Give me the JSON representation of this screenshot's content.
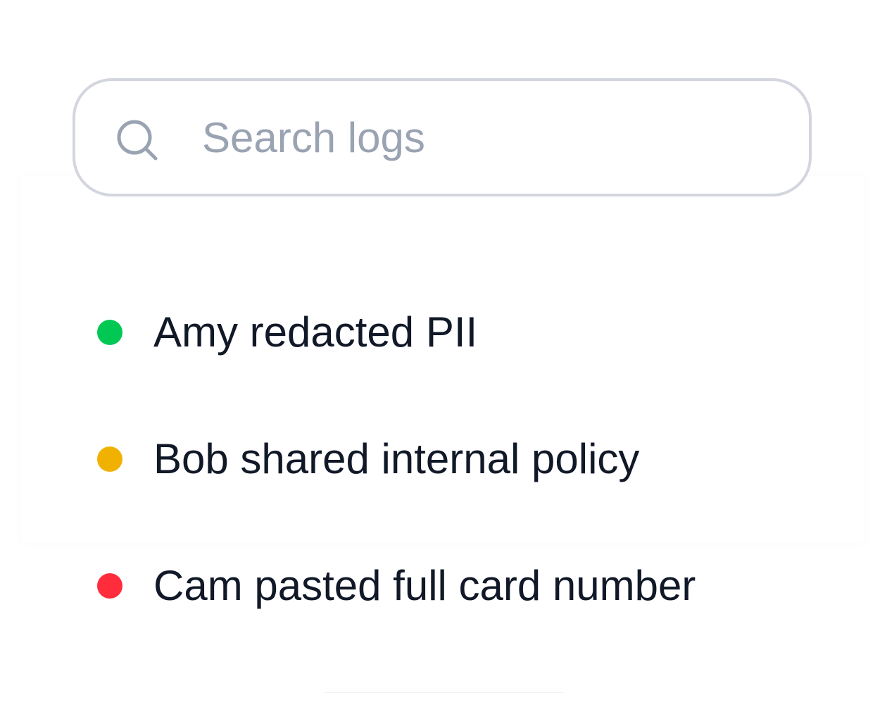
{
  "search": {
    "placeholder": "Search logs",
    "icon": "search-icon"
  },
  "logs": [
    {
      "text": "Amy redacted PII",
      "status": "ok",
      "color": "#00c853"
    },
    {
      "text": "Bob shared internal policy",
      "status": "warning",
      "color": "#f0b100"
    },
    {
      "text": "Cam pasted full card number",
      "status": "danger",
      "color": "#ff2d3b"
    }
  ]
}
